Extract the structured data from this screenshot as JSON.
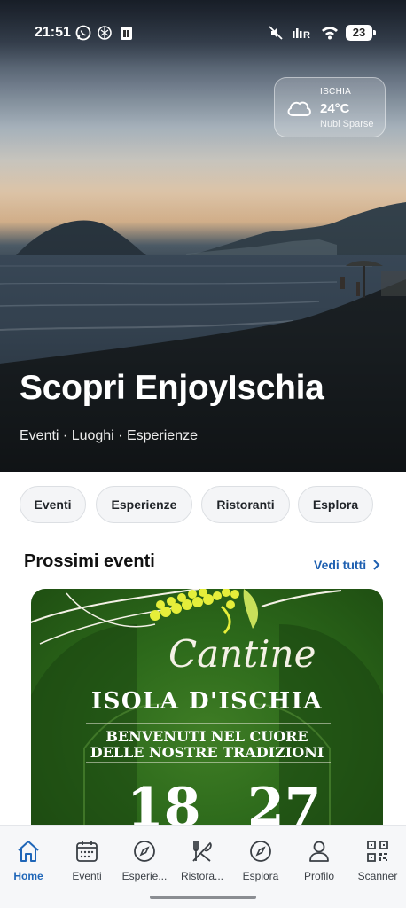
{
  "status_bar": {
    "time": "21:51",
    "battery": "23",
    "left_icons": [
      "whatsapp-icon",
      "chatgpt-icon",
      "sim-notification-icon"
    ],
    "right_icons": [
      "mute-icon",
      "signal-icon",
      "wifi-icon",
      "battery-icon"
    ]
  },
  "weather": {
    "location": "ISCHIA",
    "temperature": "24°C",
    "condition": "Nubi Sparse",
    "icon": "cloud-icon"
  },
  "hero": {
    "title": "Scopri EnjoyIschia",
    "subtitle": "Eventi · Luoghi · Esperienze"
  },
  "chips": [
    {
      "label": "Eventi"
    },
    {
      "label": "Esperienze"
    },
    {
      "label": "Ristoranti"
    },
    {
      "label": "Esplora"
    }
  ],
  "upcoming": {
    "title": "Prossimi eventi",
    "see_all": "Vedi tutti"
  },
  "event_card": {
    "script_text": "Cantine",
    "headline": "ISOLA D'ISCHIA",
    "tagline_1": "BENVENUTI NEL CUORE",
    "tagline_2": "DELLE NOSTRE TRADIZIONI",
    "date_start": "18",
    "date_end": "27"
  },
  "bottom_nav": [
    {
      "label": "Home",
      "icon": "home-icon",
      "active": true
    },
    {
      "label": "Eventi",
      "icon": "calendar-icon",
      "active": false
    },
    {
      "label": "Esperie...",
      "icon": "compass-icon",
      "active": false
    },
    {
      "label": "Ristora...",
      "icon": "utensils-icon",
      "active": false
    },
    {
      "label": "Esplora",
      "icon": "compass-icon",
      "active": false
    },
    {
      "label": "Profilo",
      "icon": "user-icon",
      "active": false
    },
    {
      "label": "Scanner",
      "icon": "qr-code-icon",
      "active": false
    }
  ],
  "colors": {
    "accent": "#1f66b8",
    "link": "#1d5fb0",
    "card_green": "#2d6a1b",
    "chip_bg": "#f4f5f7"
  }
}
